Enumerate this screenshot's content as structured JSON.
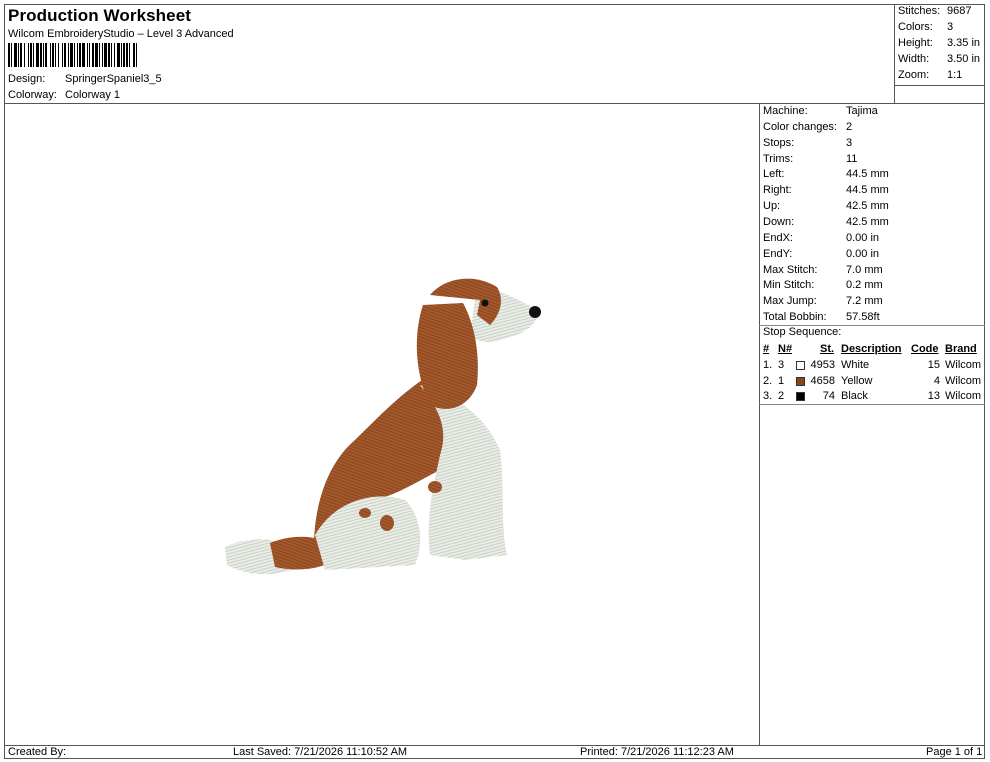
{
  "header": {
    "title": "Production Worksheet",
    "subtitle": "Wilcom EmbroideryStudio – Level 3 Advanced",
    "design_label": "Design:",
    "design_value": "SpringerSpaniel3_5",
    "colorway_label": "Colorway:",
    "colorway_value": "Colorway 1"
  },
  "summary": {
    "stitches_label": "Stitches:",
    "stitches_value": "9687",
    "colors_label": "Colors:",
    "colors_value": "3",
    "height_label": "Height:",
    "height_value": "3.35 in",
    "width_label": "Width:",
    "width_value": "3.50 in",
    "zoom_label": "Zoom:",
    "zoom_value": "1:1"
  },
  "machine": {
    "rows": [
      {
        "label": "Machine:",
        "value": "Tajima"
      },
      {
        "label": "Color changes:",
        "value": "2"
      },
      {
        "label": "Stops:",
        "value": "3"
      },
      {
        "label": "Trims:",
        "value": "11"
      },
      {
        "label": "Left:",
        "value": "44.5 mm"
      },
      {
        "label": "Right:",
        "value": "44.5 mm"
      },
      {
        "label": "Up:",
        "value": "42.5 mm"
      },
      {
        "label": "Down:",
        "value": "42.5 mm"
      },
      {
        "label": "EndX:",
        "value": "0.00 in"
      },
      {
        "label": "EndY:",
        "value": "0.00 in"
      },
      {
        "label": "Max Stitch:",
        "value": "7.0 mm"
      },
      {
        "label": "Min Stitch:",
        "value": "0.2 mm"
      },
      {
        "label": "Max Jump:",
        "value": "7.2 mm"
      },
      {
        "label": "Total Bobbin:",
        "value": "57.58ft"
      }
    ]
  },
  "stop_sequence": {
    "title": "Stop Sequence:",
    "headers": {
      "num": "#",
      "needle": "N#",
      "stitches": "St.",
      "description": "Description",
      "code": "Code",
      "brand": "Brand"
    },
    "rows": [
      {
        "num": "1.",
        "needle": "3",
        "color": "#ffffff",
        "stitches": "4953",
        "description": "White",
        "code": "15",
        "brand": "Wilcom"
      },
      {
        "num": "2.",
        "needle": "1",
        "color": "#8b4513",
        "stitches": "4658",
        "description": "Yellow",
        "code": "4",
        "brand": "Wilcom"
      },
      {
        "num": "3.",
        "needle": "2",
        "color": "#000000",
        "stitches": "74",
        "description": "Black",
        "code": "13",
        "brand": "Wilcom"
      }
    ]
  },
  "footer": {
    "created_by": "Created By:",
    "last_saved": "Last Saved: 7/21/2026 11:10:52 AM",
    "printed": "Printed: 7/21/2026 11:12:23 AM",
    "page": "Page 1 of 1"
  },
  "colors": {
    "brown": "#a0582a",
    "white_thread": "#e8ece4",
    "border": "#555555"
  }
}
